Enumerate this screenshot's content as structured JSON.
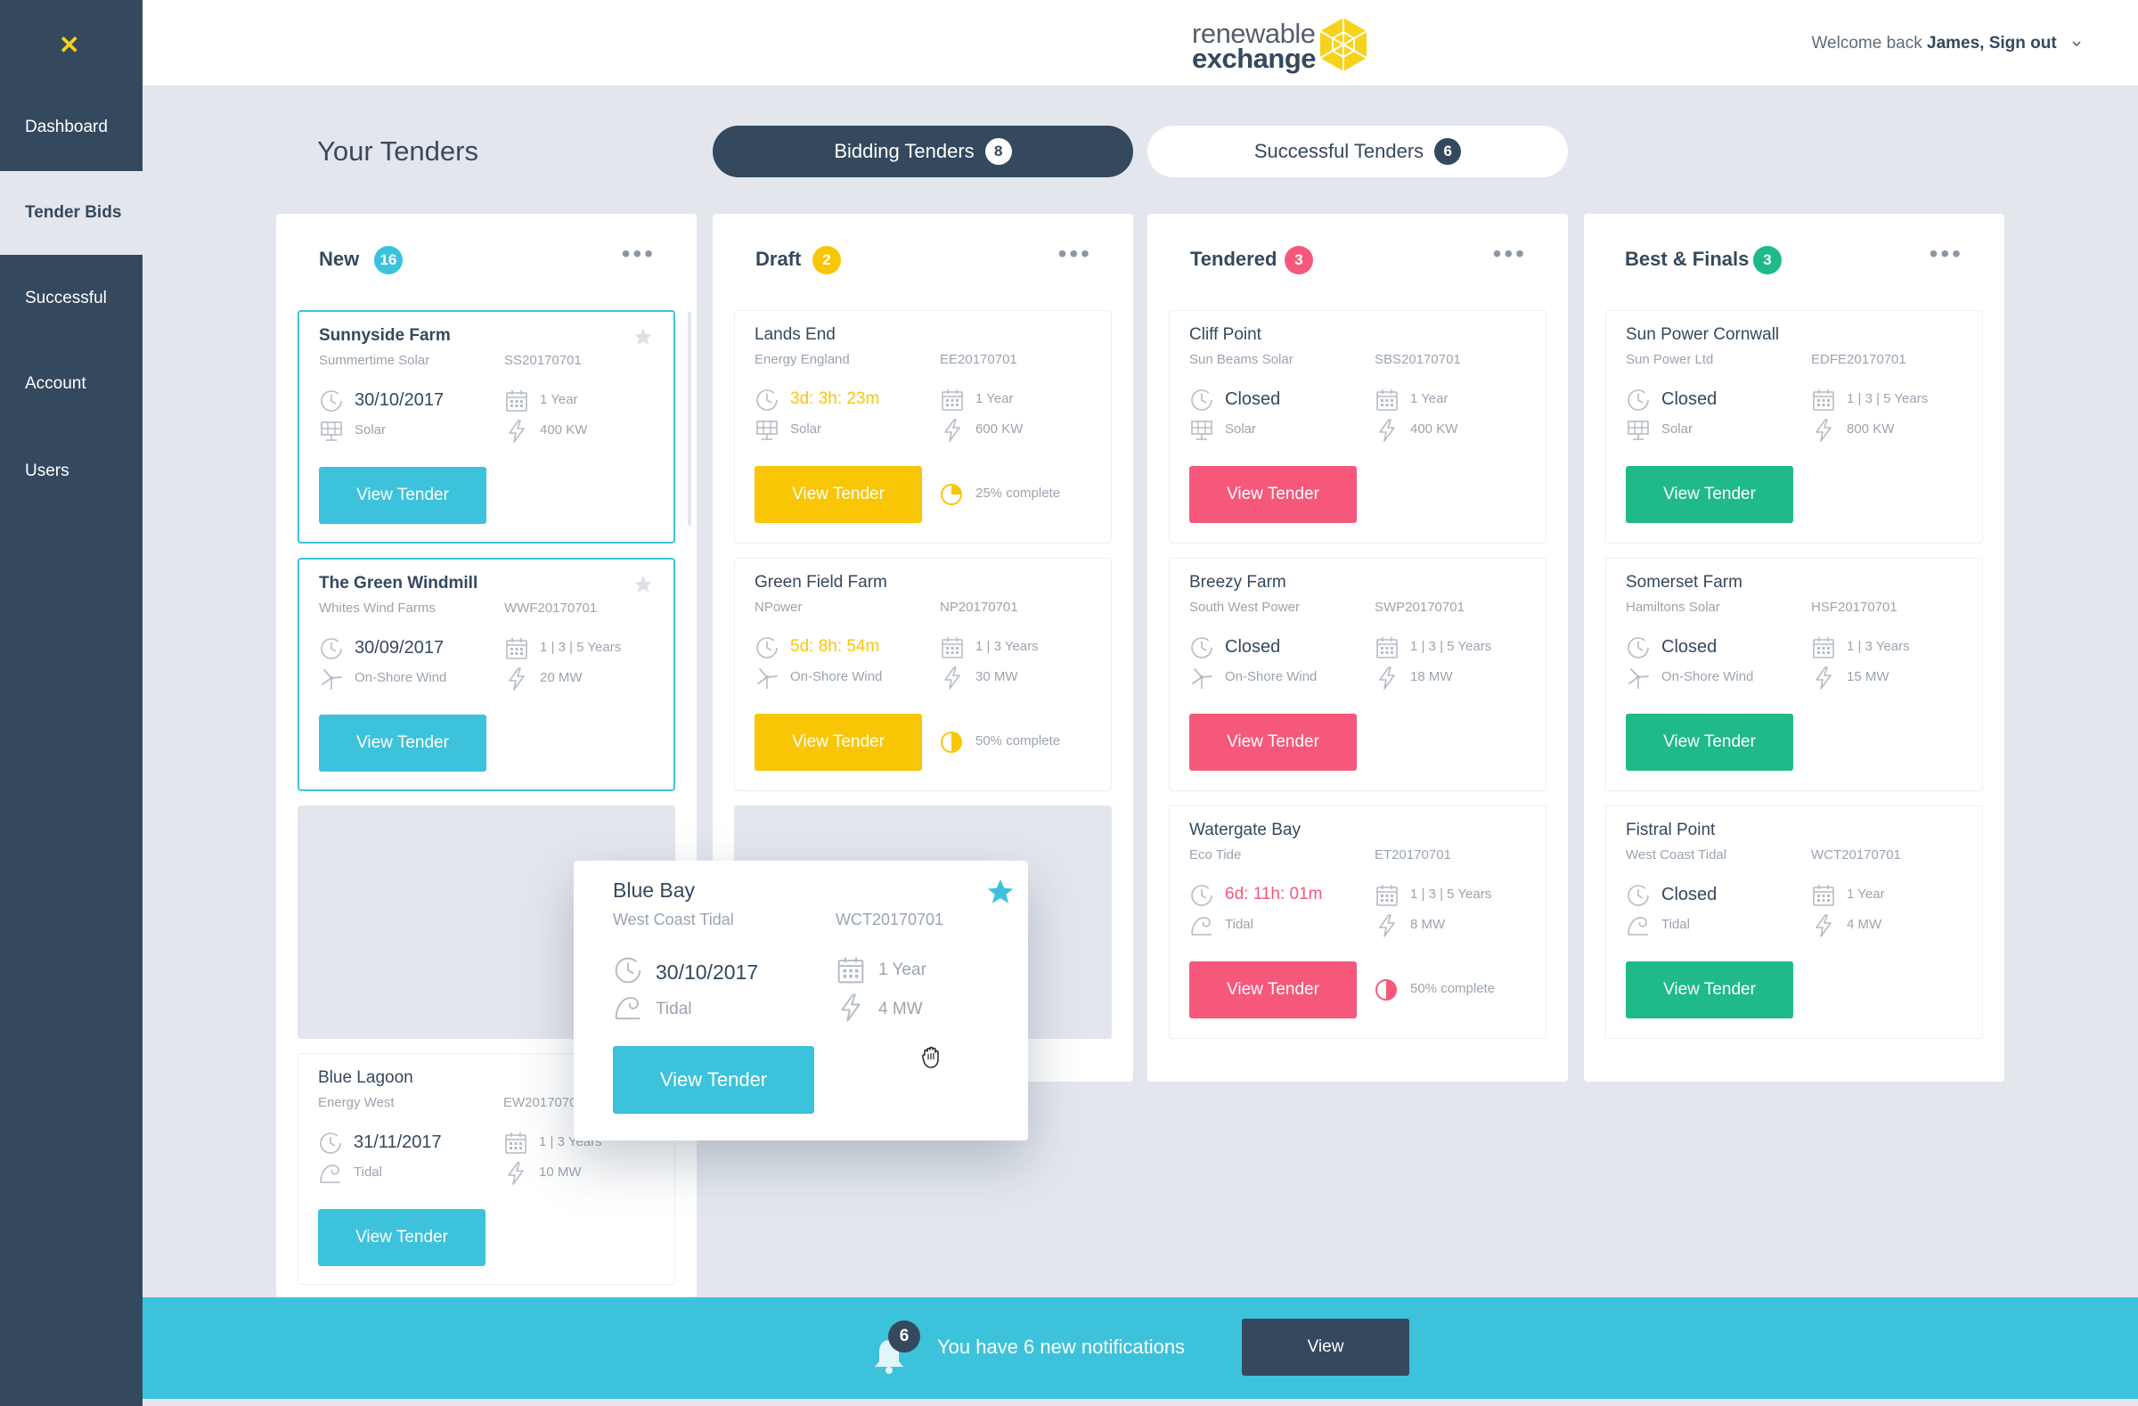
{
  "app": {
    "logo_line1": "renewable",
    "logo_line2": "exchange",
    "welcome_prefix": "Welcome back",
    "welcome_user": "James, Sign out"
  },
  "sidebar": {
    "items": [
      {
        "label": "Dashboard"
      },
      {
        "label": "Tender Bids"
      },
      {
        "label": "Successful"
      },
      {
        "label": "Account"
      },
      {
        "label": "Users"
      }
    ]
  },
  "page": {
    "title": "Your Tenders"
  },
  "tabs": [
    {
      "label": "Bidding Tenders",
      "count": "8"
    },
    {
      "label": "Successful Tenders",
      "count": "6"
    }
  ],
  "colors": {
    "new": "#3dc2dc",
    "draft": "#f9c606",
    "tendered": "#f5587b",
    "best": "#1fb98a",
    "navy": "#34495e",
    "logo_yellow": "#f7d21a"
  },
  "columns": [
    {
      "title": "New",
      "count": "16",
      "cards": [
        {
          "name": "Sunnyside Farm",
          "company": "Summertime Solar",
          "ref": "SS20170701",
          "date": "30/10/2017",
          "type": "Solar",
          "term": "1 Year",
          "power": "400 KW",
          "button": "View Tender",
          "starred": false,
          "icon": "solar-panel-icon"
        },
        {
          "name": "The Green Windmill",
          "company": "Whites Wind Farms",
          "ref": "WWF20170701",
          "date": "30/09/2017",
          "type": "On-Shore Wind",
          "term": "1 | 3 | 5 Years",
          "power": "20 MW",
          "button": "View Tender",
          "starred": false,
          "icon": "wind-turbine-icon"
        },
        {
          "name": "Blue Lagoon",
          "company": "Energy West",
          "ref": "EW2017070",
          "date": "31/11/2017",
          "type": "Tidal",
          "term": "1 | 3 Years",
          "power": "10 MW",
          "button": "View Tender",
          "icon": "wave-icon"
        }
      ]
    },
    {
      "title": "Draft",
      "count": "2",
      "cards": [
        {
          "name": "Lands End",
          "company": "Energy England",
          "ref": "EE20170701",
          "date": "3d: 3h: 23m",
          "type": "Solar",
          "term": "1 Year",
          "power": "600 KW",
          "button": "View Tender",
          "progress_text": "25% complete",
          "progress": 0.25,
          "icon": "solar-panel-icon"
        },
        {
          "name": "Green Field Farm",
          "company": "NPower",
          "ref": "NP20170701",
          "date": "5d: 8h: 54m",
          "type": "On-Shore Wind",
          "term": "1 | 3 Years",
          "power": "30 MW",
          "button": "View Tender",
          "progress_text": "50% complete",
          "progress": 0.5,
          "icon": "wind-turbine-icon"
        }
      ]
    },
    {
      "title": "Tendered",
      "count": "3",
      "cards": [
        {
          "name": "Cliff Point",
          "company": "Sun Beams Solar",
          "ref": "SBS20170701",
          "date": "Closed",
          "type": "Solar",
          "term": "1 Year",
          "power": "400 KW",
          "button": "View Tender",
          "icon": "solar-panel-icon"
        },
        {
          "name": "Breezy Farm",
          "company": "South West Power",
          "ref": "SWP20170701",
          "date": "Closed",
          "type": "On-Shore Wind",
          "term": "1 | 3 | 5 Years",
          "power": "18 MW",
          "button": "View Tender",
          "icon": "wind-turbine-icon"
        },
        {
          "name": "Watergate Bay",
          "company": "Eco Tide",
          "ref": "ET20170701",
          "date": "6d: 11h: 01m",
          "type": "Tidal",
          "term": "1 | 3 | 5 Years",
          "power": "8 MW",
          "button": "View Tender",
          "progress_text": "50% complete",
          "progress": 0.5,
          "icon": "wave-icon"
        }
      ]
    },
    {
      "title": "Best & Finals",
      "count": "3",
      "cards": [
        {
          "name": "Sun Power Cornwall",
          "company": "Sun Power Ltd",
          "ref": "EDFE20170701",
          "date": "Closed",
          "type": "Solar",
          "term": "1 | 3 | 5 Years",
          "power": "800 KW",
          "button": "View Tender",
          "icon": "solar-panel-icon"
        },
        {
          "name": "Somerset Farm",
          "company": "Hamiltons Solar",
          "ref": "HSF20170701",
          "date": "Closed",
          "type": "On-Shore Wind",
          "term": "1 | 3 Years",
          "power": "15 MW",
          "button": "View Tender",
          "icon": "wind-turbine-icon"
        },
        {
          "name": "Fistral Point",
          "company": "West Coast Tidal",
          "ref": "WCT20170701",
          "date": "Closed",
          "type": "Tidal",
          "term": "1 Year",
          "power": "4 MW",
          "button": "View Tender",
          "icon": "wave-icon"
        }
      ]
    }
  ],
  "dragging_card": {
    "name": "Blue Bay",
    "company": "West Coast Tidal",
    "ref": "WCT20170701",
    "date": "30/10/2017",
    "type": "Tidal",
    "term": "1 Year",
    "power": "4 MW",
    "button": "View Tender",
    "starred": true
  },
  "notifications": {
    "count": "6",
    "text": "You have 6 new notifications",
    "button": "View"
  }
}
